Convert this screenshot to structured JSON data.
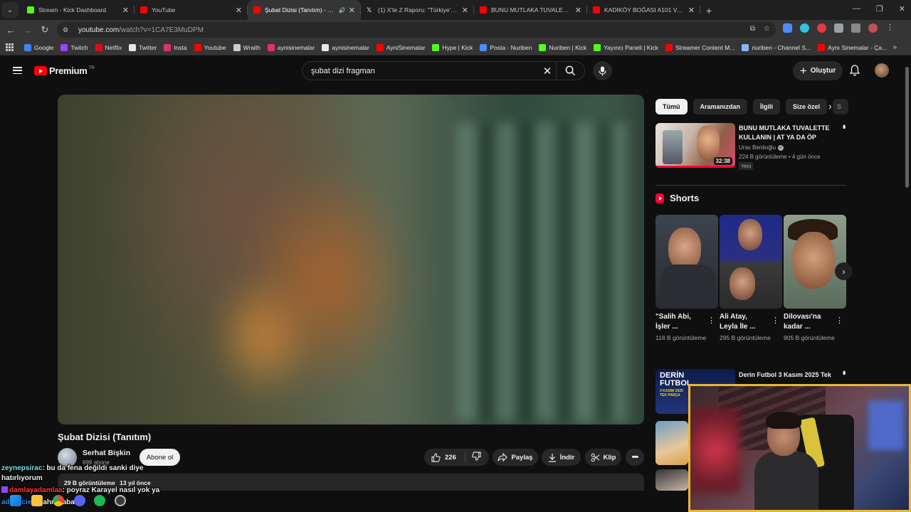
{
  "browser": {
    "tabs": [
      {
        "title": "Stream - Kick Dashboard",
        "favicon_color": "#53fc18",
        "active": false,
        "audio": false
      },
      {
        "title": "YouTube",
        "favicon_color": "#ff0000",
        "active": false,
        "audio": false
      },
      {
        "title": "Şubat Dizisi (Tanıtım) - YouTube",
        "favicon_color": "#ff0000",
        "active": true,
        "audio": true
      },
      {
        "title": "(1) X'te Z Raporu: \"Türkiye'nin g",
        "favicon_color": "#ffffff",
        "active": false,
        "audio": false
      },
      {
        "title": "BUNU MUTLAKA TUVALETTE KULLANIN",
        "favicon_color": "#ff0000",
        "active": false,
        "audio": false
      },
      {
        "title": "KADIKÖY BOĞASI A101 VS BİM",
        "favicon_color": "#ff0000",
        "active": false,
        "audio": false
      }
    ],
    "url_host": "youtube.com",
    "url_path": "/watch?v=1CA7E3MuDPM",
    "bookmarks": [
      {
        "label": "Google",
        "color": "#4285f4"
      },
      {
        "label": "Twitch",
        "color": "#9146ff"
      },
      {
        "label": "Netflix",
        "color": "#e50914"
      },
      {
        "label": "Twitter",
        "color": "#e7e7e7"
      },
      {
        "label": "Insta",
        "color": "#e1306c"
      },
      {
        "label": "Youtube",
        "color": "#ff0000"
      },
      {
        "label": "Wraith",
        "color": "#cccccc"
      },
      {
        "label": "aynisinemalar",
        "color": "#e1306c"
      },
      {
        "label": "aynisinemalar",
        "color": "#e7e7e7"
      },
      {
        "label": "AyniSinemalar",
        "color": "#ff0000"
      },
      {
        "label": "Hype | Kick",
        "color": "#53fc18"
      },
      {
        "label": "Posta - Nuriben",
        "color": "#4a8cff"
      },
      {
        "label": "Nuriben | Kick",
        "color": "#53fc18"
      },
      {
        "label": "Yayıncı Paneli | Kick",
        "color": "#53fc18"
      },
      {
        "label": "Streamer Content M...",
        "color": "#ff0000"
      },
      {
        "label": "nuriben - Channel S...",
        "color": "#8ab4f8"
      },
      {
        "label": "Aynı Sinemalar - Ça...",
        "color": "#ff0000"
      }
    ]
  },
  "youtube": {
    "logo_text": "Premium",
    "logo_region": "TR",
    "search_query": "şubat dizi fragman",
    "create_label": "Oluştur",
    "video": {
      "title": "Şubat Dizisi (Tanıtım)",
      "channel": "Serhat Bişkin",
      "subscribers": "699 abone",
      "subscribe_label": "Abone ol",
      "likes": "226",
      "share_label": "Paylaş",
      "download_label": "İndir",
      "clip_label": "Klip",
      "views": "29 B görüntüleme",
      "age": "13 yıl önce"
    },
    "chips": [
      "Tümü",
      "Aramanızdan",
      "İlgili",
      "Size özel",
      "S"
    ],
    "recommended": {
      "title": "BUNU MUTLAKA TUVALETTE KULLANIN | AT YA DA ÖP",
      "channel": "Uras Benlioğlu",
      "meta": "224 B görüntüleme • 4 gün önce",
      "badge": "Yeni",
      "duration": "32:38"
    },
    "shorts_heading": "Shorts",
    "shorts": [
      {
        "title": "\"Salih Abi, İşler ...",
        "views": "118 B görüntüleme"
      },
      {
        "title": "Ali Atay, Leyla İle ...",
        "views": "295 B görüntüleme"
      },
      {
        "title": "Dilovası'na kadar ...",
        "views": "905 B görüntüleme"
      }
    ],
    "recommended2": {
      "title": "Derin Futbol 3 Kasım 2025 Tek",
      "thumb_title": "DERİN FUTBOL",
      "thumb_sub": "3 KASIM 2025 TEK PARÇA"
    }
  },
  "chat": [
    {
      "user": "zeynepsirac",
      "message": ": bu da fena değildi sanki diye hatırlıyorum"
    },
    {
      "user": "damlayadamlaa",
      "message": ": poyraz Karayel nasıl yok ya"
    },
    {
      "user": "adaxscier",
      "message": ": bahri baba"
    }
  ]
}
